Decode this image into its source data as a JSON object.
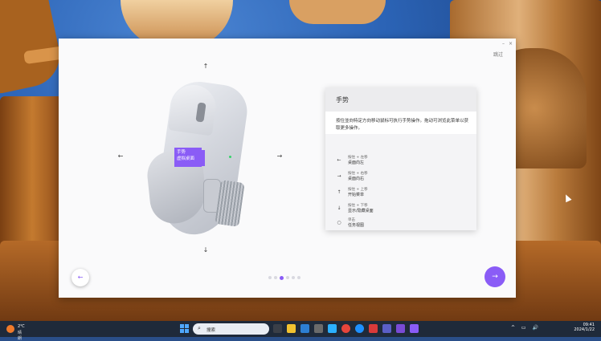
{
  "dialog": {
    "skip_label": "跳过",
    "minimize_label": "–",
    "close_label": "×",
    "gesture_label_line1": "手势",
    "gesture_label_line2": "虚拟桌面",
    "panel": {
      "title": "手势",
      "description": "按住並向特定方向移动鼠标可执行手势操作。拖动可浏览此菜单以获取更多操作。",
      "gestures": [
        {
          "icon": "arrow-left-icon",
          "glyph": "←",
          "hint": "按住 + 左移",
          "action": "桌面向左"
        },
        {
          "icon": "arrow-right-icon",
          "glyph": "→",
          "hint": "按住 + 右移",
          "action": "桌面向右"
        },
        {
          "icon": "arrow-up-icon",
          "glyph": "↑",
          "hint": "按住 + 上移",
          "action": "开始菜单"
        },
        {
          "icon": "arrow-down-icon",
          "glyph": "↓",
          "hint": "按住 + 下移",
          "action": "显示/隐藏桌面"
        },
        {
          "icon": "circle-icon",
          "glyph": "○",
          "hint": "单击",
          "action": "任务视图"
        }
      ]
    },
    "nav": {
      "back_glyph": "←",
      "next_glyph": "→",
      "page_count": 6,
      "active_page": 3
    },
    "direction_glyphs": {
      "up": "↑",
      "down": "↓",
      "left": "←",
      "right": "→"
    }
  },
  "taskbar": {
    "weather_temp": "2℃",
    "weather_desc": "晴朗",
    "search_placeholder": "搜索",
    "time": "09:41",
    "date": "2024/1/22"
  },
  "colors": {
    "accent": "#8a5cf6",
    "dialog_bg": "#fafafb",
    "taskbar_bg": "#1f2a3a"
  }
}
